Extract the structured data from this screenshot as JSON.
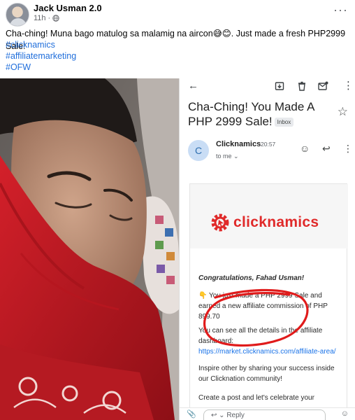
{
  "post": {
    "author": "Jack Usman 2.0",
    "time": "11h",
    "privacy_icon": "globe-icon",
    "more_icon": "more-horizontal-icon",
    "text": "Cha-ching! Muna bago matulog sa malamig na aircon😅😊. Just made a fresh PHP2999 Sale!",
    "hashtags": [
      "#clicknamics",
      "#affiliatemarketing",
      "#OFW"
    ]
  },
  "email": {
    "subject": "Cha-Ching! You Made A PHP 2999 Sale!",
    "label": "Inbox",
    "sender_initial": "C",
    "sender": "Clicknamics",
    "time": "20:57",
    "recipient": "to me ⌄",
    "brand": "clicknamics",
    "greeting": "Congratulations, Fahad Usman!",
    "para1": "👇 You just made a PHP 2999 Sale and earned a new affiliate commission of PHP 899.70",
    "para2_prefix": "You can see all the details in the affiliate dashboard: ",
    "para2_link": "https://market.clicknamics.com/affiliate-area/",
    "para3": "Inspire other by sharing your success inside our Clicknation community!",
    "para4": "Create a post and let's celebrate your",
    "reply_placeholder": "Reply"
  },
  "colors": {
    "link_blue": "#216fdb",
    "brand_red": "#e02a2a",
    "circle_red": "#e01b1b"
  }
}
